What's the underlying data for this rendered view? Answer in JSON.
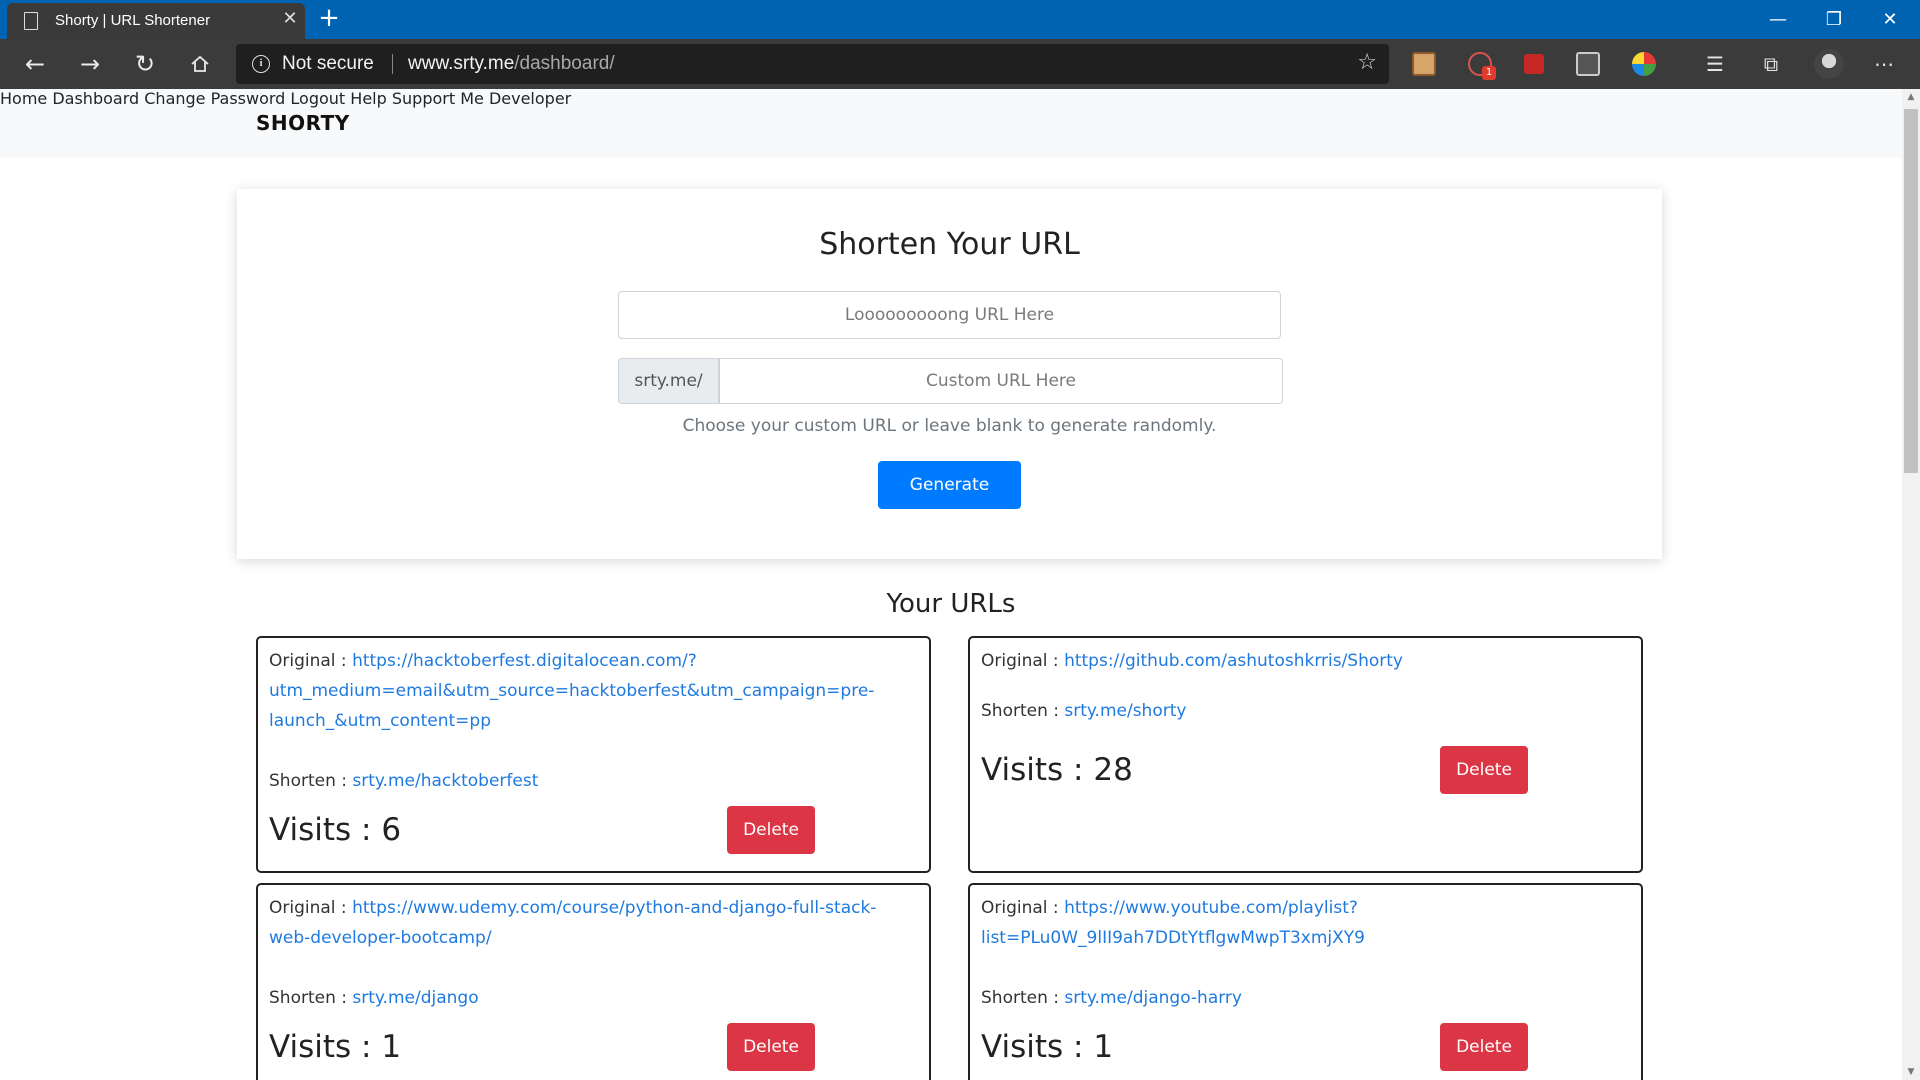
{
  "browser": {
    "tab_title": "Shorty | URL Shortener",
    "new_tab_glyph": "+",
    "security_label": "Not secure",
    "url_host": "www.srty.me",
    "url_path": "/dashboard/",
    "theme_color": "#0063b1"
  },
  "site": {
    "brand": "SHORTY",
    "nav": [
      "Home",
      "Dashboard",
      "Change Password",
      "Logout",
      "Help",
      "Support Me",
      "Developer"
    ]
  },
  "shorten_form": {
    "heading": "Shorten Your URL",
    "long_url_placeholder": "Looooooooong URL Here",
    "prefix": "srty.me/",
    "custom_placeholder": "Custom URL Here",
    "help": "Choose your custom URL or leave blank to generate randomly.",
    "generate_label": "Generate",
    "accent": "#007bff"
  },
  "urls_section": {
    "title": "Your URLs",
    "original_label": "Original :",
    "shorten_label": "Shorten :",
    "visits_label": "Visits :",
    "delete_label": "Delete",
    "delete_color": "#dc3545",
    "items": [
      {
        "original": "https://hacktoberfest.digitalocean.com/?utm_medium=email&utm_source=hacktoberfest&utm_campaign=pre-launch_&utm_content=pp",
        "original_lines": [
          "https://hacktoberfest.digitalocean.com/?",
          "utm_medium=email&utm_source=hacktoberfest&utm_campaign=pre-",
          "launch_&utm_content=pp"
        ],
        "short": "srty.me/hacktoberfest",
        "visits": "6"
      },
      {
        "original": "https://github.com/ashutoshkrris/Shorty",
        "original_lines": [
          "https://github.com/ashutoshkrris/Shorty"
        ],
        "short": "srty.me/shorty",
        "visits": "28"
      },
      {
        "original": "https://www.udemy.com/course/python-and-django-full-stack-web-developer-bootcamp/",
        "original_lines": [
          "https://www.udemy.com/course/python-and-django-full-stack-",
          "web-developer-bootcamp/"
        ],
        "short": "srty.me/django",
        "visits": "1"
      },
      {
        "original": "https://www.youtube.com/playlist?list=PLu0W_9lII9ah7DDtYtflgwMwpT3xmjXY9",
        "original_lines": [
          "https://www.youtube.com/playlist?",
          "list=PLu0W_9lII9ah7DDtYtflgwMwpT3xmjXY9"
        ],
        "short": "srty.me/django-harry",
        "visits": "1"
      }
    ]
  }
}
